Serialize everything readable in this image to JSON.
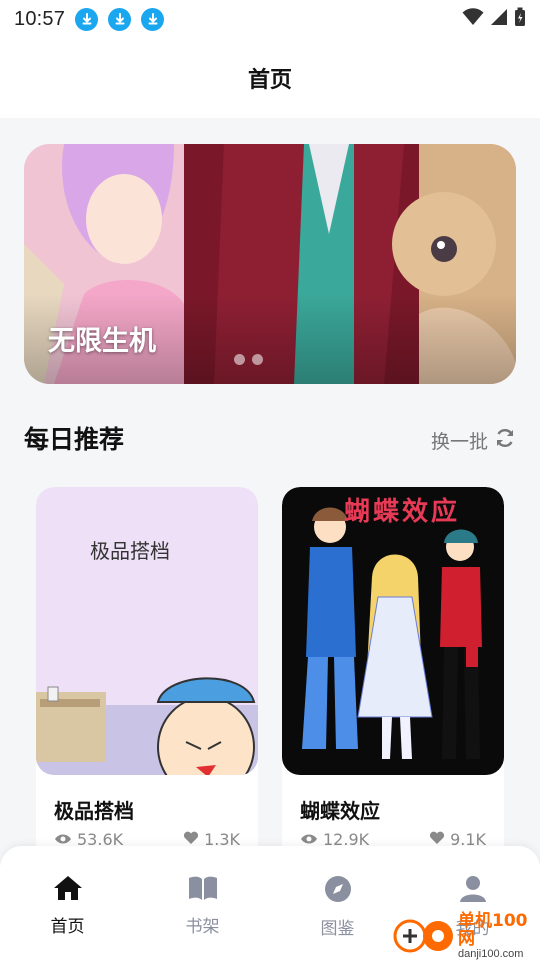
{
  "status_bar": {
    "time": "10:57"
  },
  "header": {
    "title": "首页"
  },
  "banner": {
    "title": "无限生机",
    "page_count": 2,
    "active_index": 1
  },
  "daily": {
    "title": "每日推荐",
    "refresh_label": "换一批"
  },
  "cards": [
    {
      "name": "极品搭档",
      "cover_text": "极品搭档",
      "views": "53.6K",
      "likes": "1.3K"
    },
    {
      "name": "蝴蝶效应",
      "cover_text": "蝴蝶效应",
      "views": "12.9K",
      "likes": "9.1K"
    }
  ],
  "nav": [
    {
      "label": "首页",
      "icon": "home-icon",
      "active": true
    },
    {
      "label": "书架",
      "icon": "book-icon",
      "active": false
    },
    {
      "label": "图鉴",
      "icon": "compass-icon",
      "active": false
    },
    {
      "label": "我的",
      "icon": "user-icon",
      "active": false
    }
  ],
  "watermark": {
    "text": "单机100网",
    "url": "danji100.com"
  },
  "colors": {
    "download_badge": "#1aa7ef",
    "nav_inactive": "#8b90a0",
    "watermark": "#ff6a00"
  }
}
